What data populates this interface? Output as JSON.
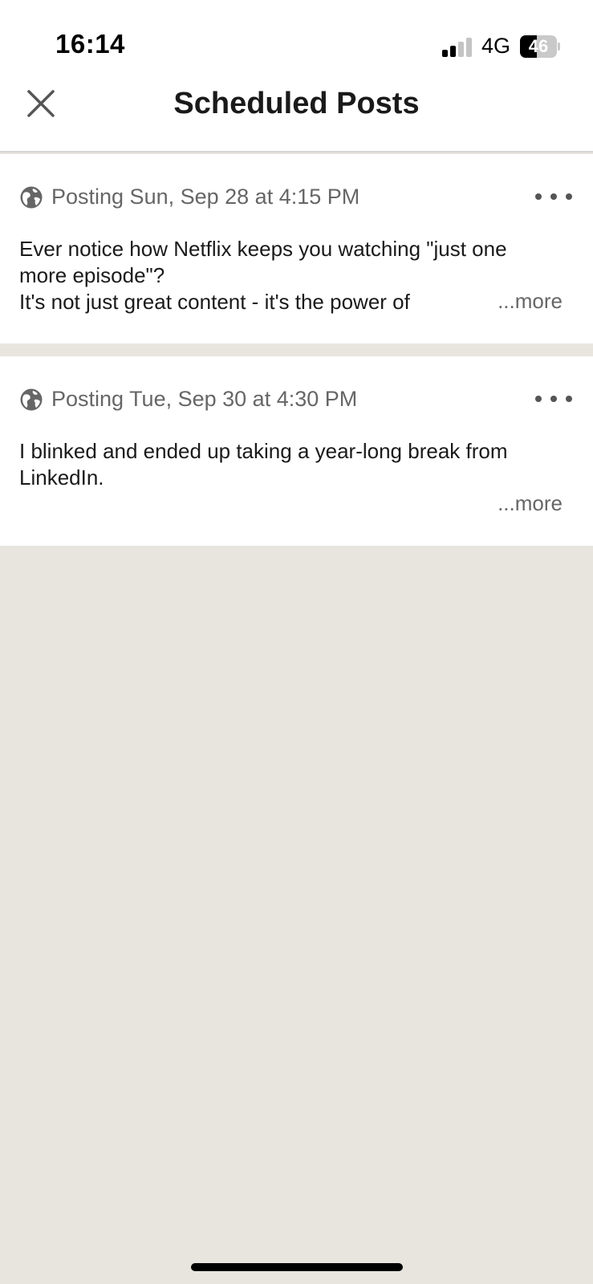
{
  "status_bar": {
    "time": "16:14",
    "network": "4G",
    "battery_level": "46",
    "battery_fraction": 0.46
  },
  "header": {
    "title": "Scheduled Posts",
    "close_icon": "close-icon"
  },
  "posts": [
    {
      "schedule": "Posting Sun, Sep 28 at 4:15 PM",
      "visibility_icon": "globe-icon",
      "lines": [
        "Ever notice how Netflix keeps you watching \"just one",
        "more episode\"?",
        "It's not just great content - it's the power of"
      ],
      "more_label": "...more"
    },
    {
      "schedule": "Posting Tue, Sep 30 at 4:30 PM",
      "visibility_icon": "globe-icon",
      "lines": [
        "I blinked and ended up taking a year-long break from",
        "LinkedIn."
      ],
      "more_label": "...more"
    }
  ],
  "colors": {
    "background": "#e8e5df",
    "card": "#ffffff",
    "muted_text": "#666666",
    "primary_text": "#1a1a1a"
  }
}
